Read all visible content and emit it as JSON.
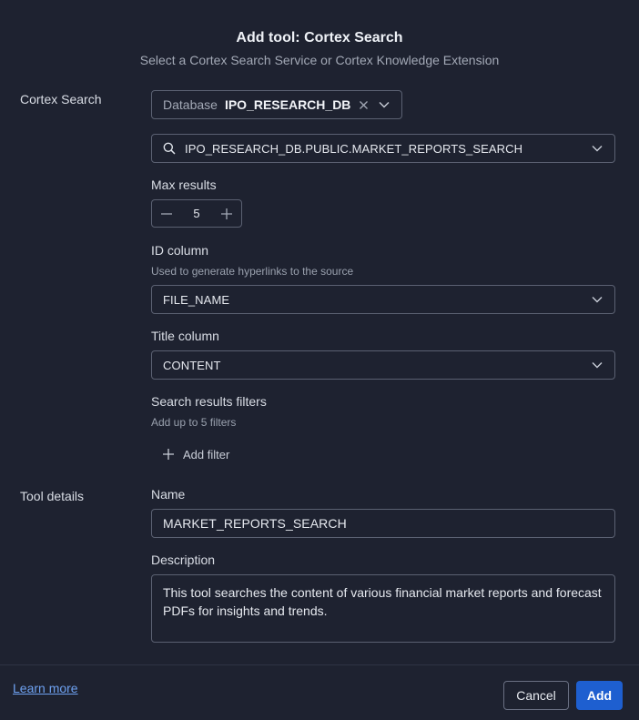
{
  "dialog": {
    "title": "Add tool: Cortex Search",
    "subtitle": "Select a Cortex Search Service or Cortex Knowledge Extension"
  },
  "cortex_search": {
    "section_label": "Cortex Search",
    "database": {
      "prefix": "Database",
      "value": "IPO_RESEARCH_DB"
    },
    "service": {
      "value": "IPO_RESEARCH_DB.PUBLIC.MARKET_REPORTS_SEARCH"
    },
    "max_results": {
      "label": "Max results",
      "value": "5"
    },
    "id_column": {
      "label": "ID column",
      "help": "Used to generate hyperlinks to the source",
      "value": "FILE_NAME"
    },
    "title_column": {
      "label": "Title column",
      "value": "CONTENT"
    },
    "filters": {
      "label": "Search results filters",
      "help": "Add up to 5 filters",
      "add_label": "Add filter"
    }
  },
  "tool_details": {
    "section_label": "Tool details",
    "name": {
      "label": "Name",
      "value": "MARKET_REPORTS_SEARCH"
    },
    "description": {
      "label": "Description",
      "value": "This tool searches the content of various financial market reports and forecast PDFs for insights and trends."
    }
  },
  "footer": {
    "learn_more": "Learn more",
    "cancel_label": "Cancel",
    "add_label": "Add"
  },
  "icons": {
    "search": "search-icon",
    "chevron": "chevron-down-icon",
    "clear": "close-icon",
    "minus": "minus-icon",
    "plus": "plus-icon"
  },
  "colors": {
    "background": "#1e2230",
    "border": "#5b6172",
    "primary": "#1e5fd0",
    "link": "#6ea1f0"
  }
}
